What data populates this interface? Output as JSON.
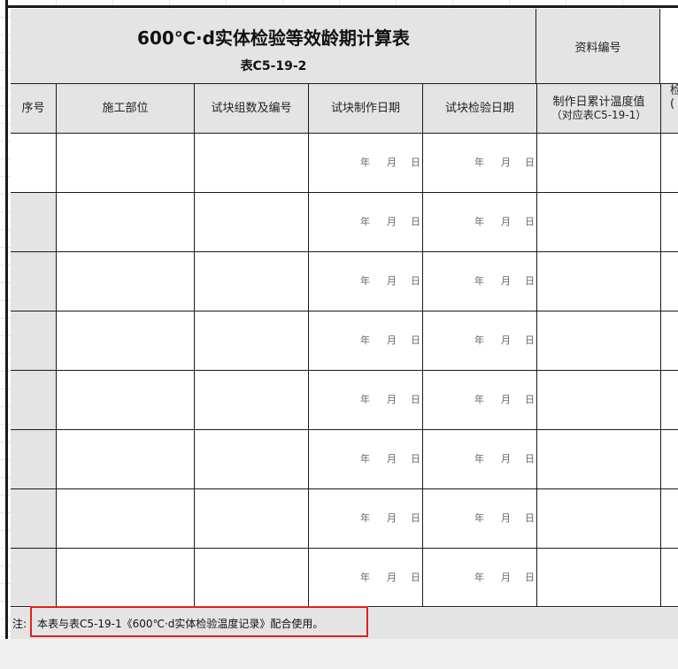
{
  "title": {
    "main": "600℃·d实体检验等效龄期计算表",
    "sub": "表C5-19-2"
  },
  "doc_label": "资料编号",
  "headers": {
    "seq": "序号",
    "location": "施工部位",
    "group": "试块组数及编号",
    "make_date": "试块制作日期",
    "test_date": "试块检验日期",
    "cumulative_line1": "制作日累计温度值",
    "cumulative_line2": "（对应表C5-19-1）",
    "partial": "检",
    "partial2": "("
  },
  "date_units": {
    "year": "年",
    "month": "月",
    "day": "日"
  },
  "row_count": 8,
  "note": {
    "prefix": "注:",
    "text": "本表与表C5-19-1《600℃·d实体检验温度记录》配合使用。"
  },
  "colors": {
    "header_fill": "#e4e4e4",
    "border": "#1a1a1a",
    "highlight": "#e02020"
  }
}
